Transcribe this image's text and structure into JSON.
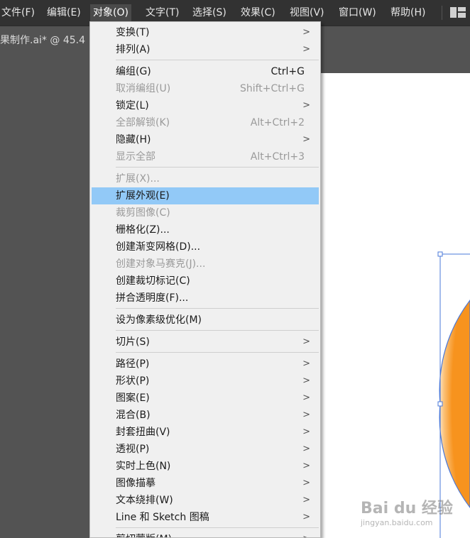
{
  "menubar": {
    "items": [
      "文件(F)",
      "编辑(E)",
      "对象(O)",
      "文字(T)",
      "选择(S)",
      "效果(C)",
      "视图(V)",
      "窗口(W)",
      "帮助(H)"
    ],
    "active": "对象(O)"
  },
  "document": {
    "tab_title": "果制作.ai* @ 45.4"
  },
  "object_menu": {
    "items": [
      {
        "label": "变换(T)",
        "submenu": true
      },
      {
        "label": "排列(A)",
        "submenu": true
      },
      {
        "label": "编组(G)",
        "shortcut": "Ctrl+G"
      },
      {
        "label": "取消编组(U)",
        "shortcut": "Shift+Ctrl+G",
        "disabled": true
      },
      {
        "label": "锁定(L)",
        "submenu": true
      },
      {
        "label": "全部解锁(K)",
        "shortcut": "Alt+Ctrl+2",
        "disabled": true
      },
      {
        "label": "隐藏(H)",
        "submenu": true
      },
      {
        "label": "显示全部",
        "shortcut": "Alt+Ctrl+3",
        "disabled": true
      },
      {
        "label": "扩展(X)...",
        "disabled": true
      },
      {
        "label": "扩展外观(E)",
        "highlighted": true
      },
      {
        "label": "裁剪图像(C)",
        "disabled": true
      },
      {
        "label": "栅格化(Z)..."
      },
      {
        "label": "创建渐变网格(D)..."
      },
      {
        "label": "创建对象马赛克(J)...",
        "disabled": true
      },
      {
        "label": "创建裁切标记(C)"
      },
      {
        "label": "拼合透明度(F)..."
      },
      {
        "label": "设为像素级优化(M)"
      },
      {
        "label": "切片(S)",
        "submenu": true
      },
      {
        "label": "路径(P)",
        "submenu": true
      },
      {
        "label": "形状(P)",
        "submenu": true
      },
      {
        "label": "图案(E)",
        "submenu": true
      },
      {
        "label": "混合(B)",
        "submenu": true
      },
      {
        "label": "封套扭曲(V)",
        "submenu": true
      },
      {
        "label": "透视(P)",
        "submenu": true
      },
      {
        "label": "实时上色(N)",
        "submenu": true
      },
      {
        "label": "图像描摹",
        "submenu": true
      },
      {
        "label": "文本绕排(W)",
        "submenu": true
      },
      {
        "label": "Line 和 Sketch 图稿",
        "submenu": true
      },
      {
        "label": "剪切蒙版(M)",
        "submenu": true
      }
    ],
    "submenu_arrow": ">"
  },
  "watermark": {
    "brand": "Bai du 经验",
    "url": "jingyan.baidu.com"
  },
  "colors": {
    "menubar_bg": "#323232",
    "menu_bg": "#f0f0f0",
    "highlight": "#92c9f7",
    "selection": "#4a78d8",
    "circle_orange": "#f7931e"
  }
}
